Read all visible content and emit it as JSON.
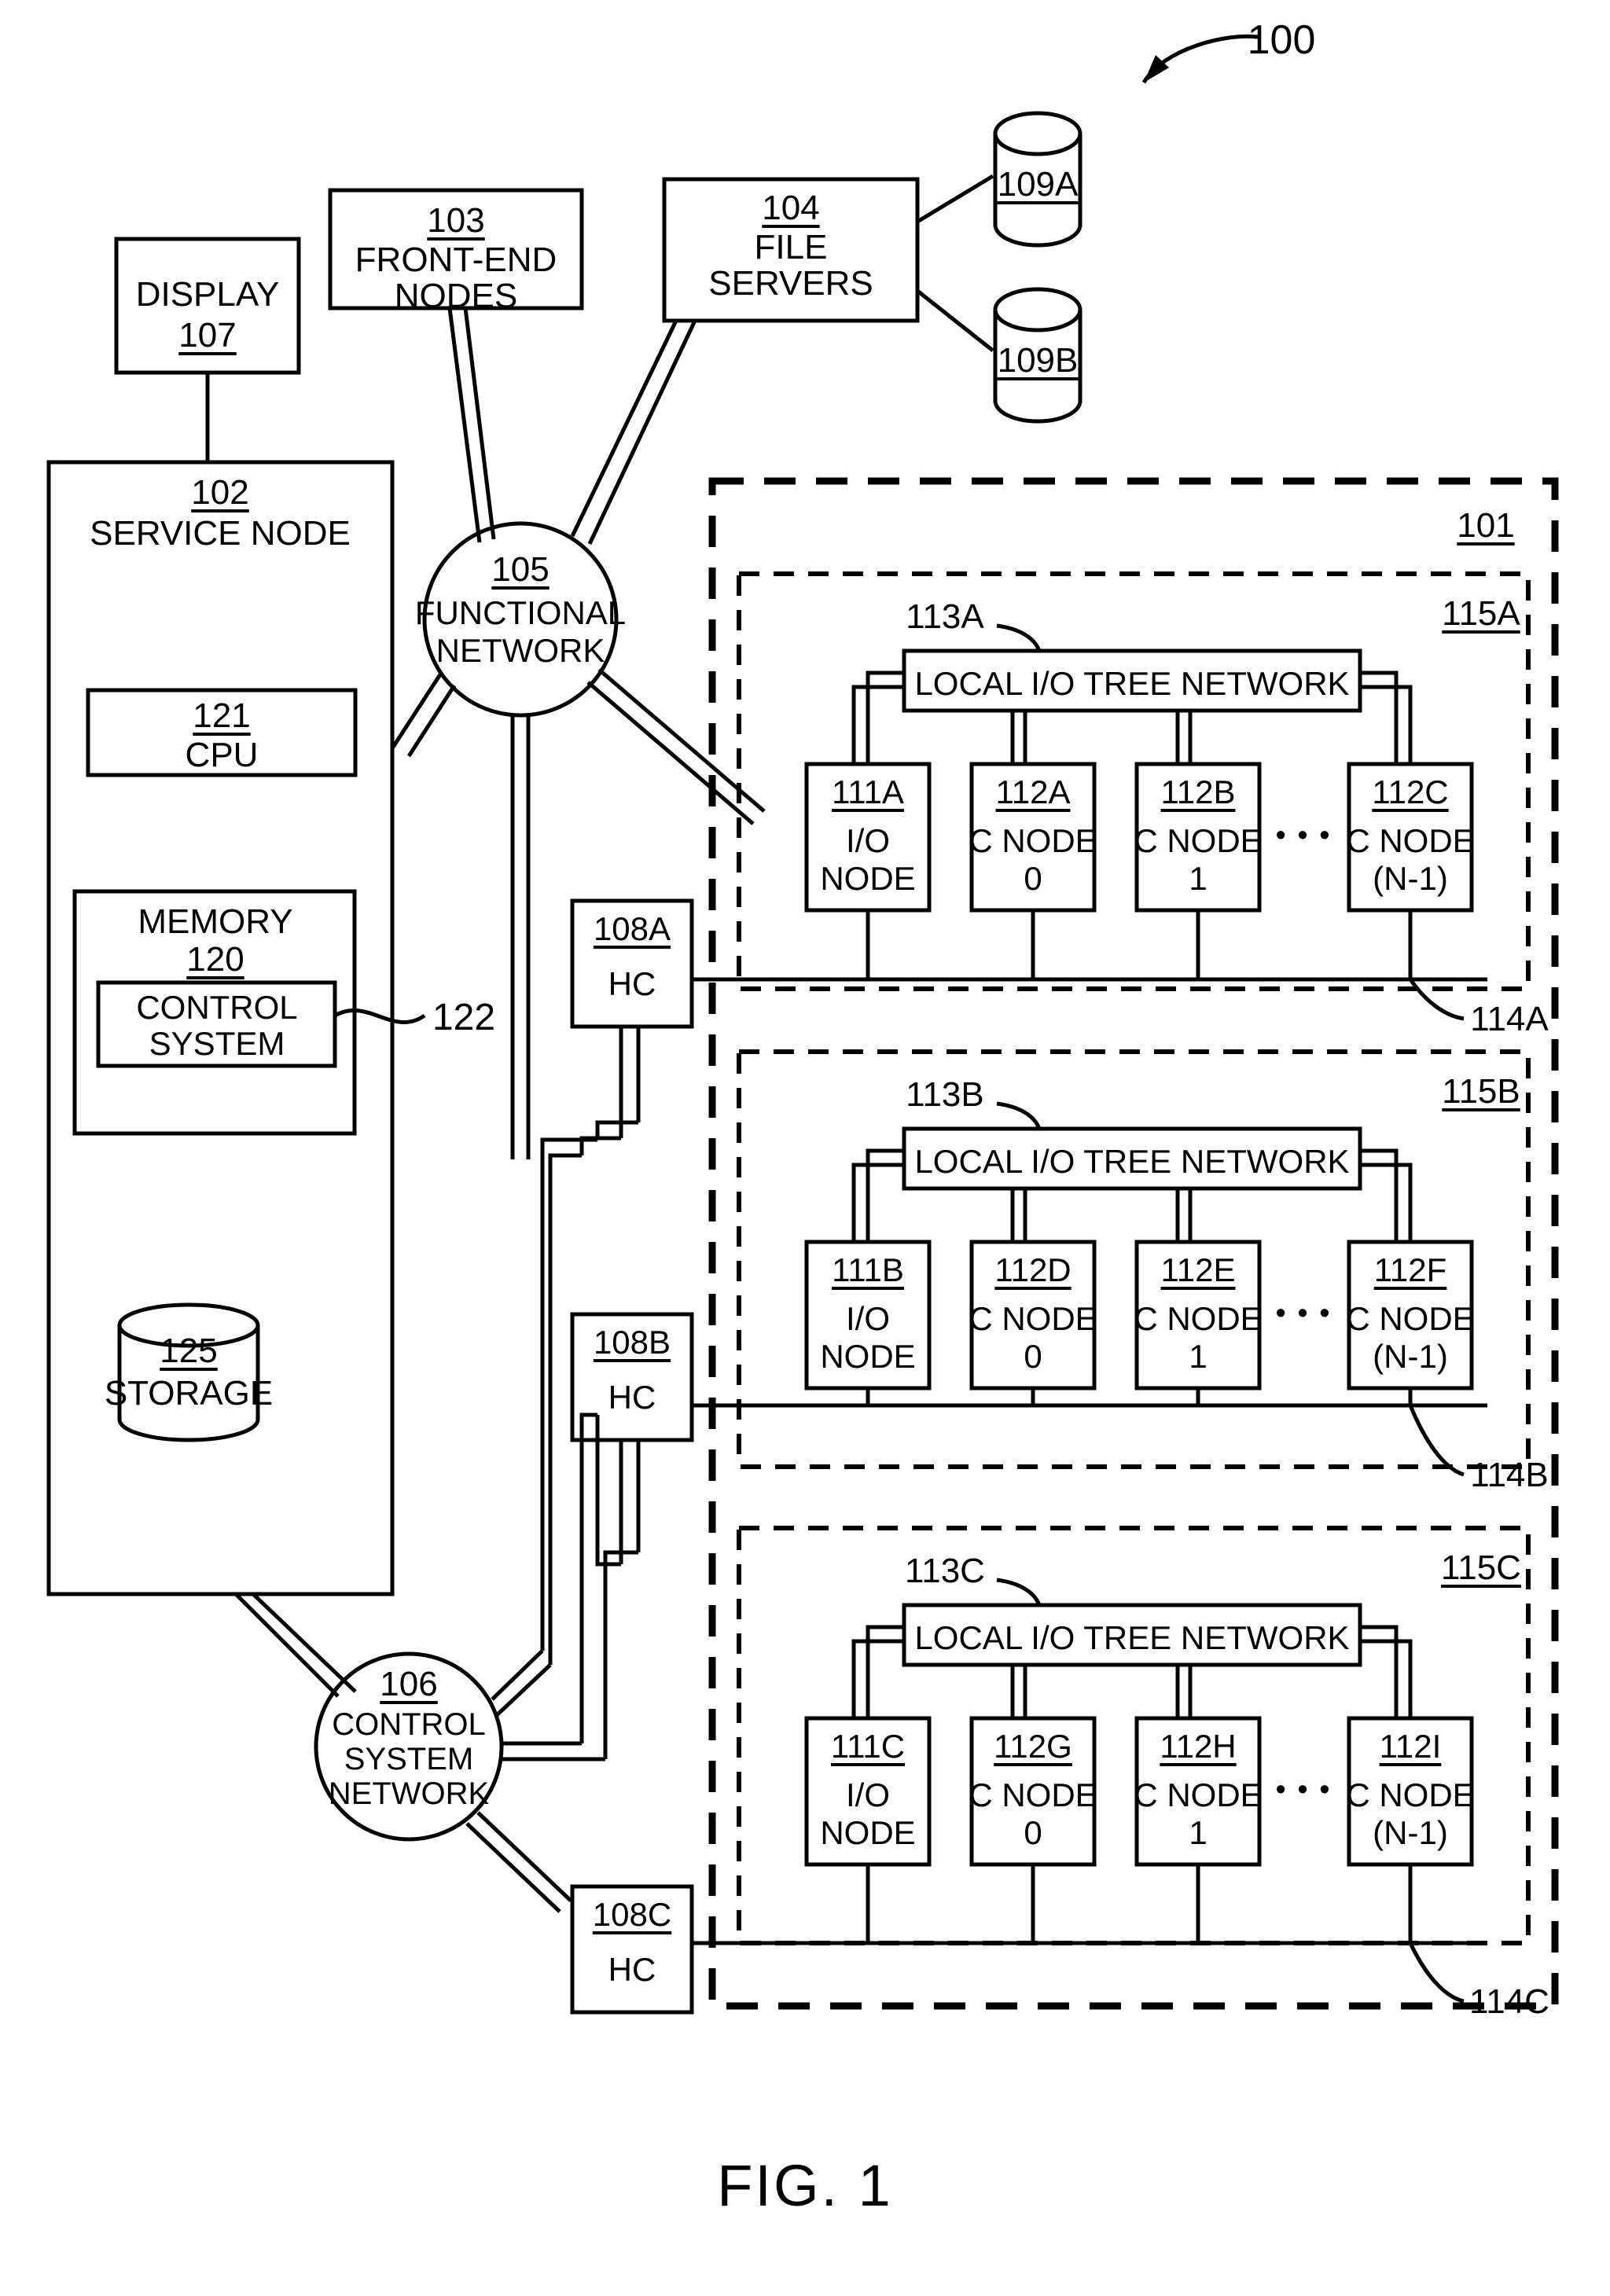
{
  "figure": {
    "caption": "FIG. 1",
    "system_ref": "100"
  },
  "blocks": {
    "display": {
      "ref": "107",
      "label": "DISPLAY"
    },
    "front_end_nodes": {
      "ref": "103",
      "label_line1": "FRONT-END",
      "label_line2": "NODES"
    },
    "file_servers": {
      "ref": "104",
      "label_line1": "FILE",
      "label_line2": "SERVERS"
    },
    "disk_a": {
      "ref": "109A"
    },
    "disk_b": {
      "ref": "109B"
    },
    "service_node": {
      "ref": "102",
      "label": "SERVICE NODE"
    },
    "cpu": {
      "ref": "121",
      "label": "CPU"
    },
    "memory": {
      "ref": "120",
      "label": "MEMORY"
    },
    "control_system": {
      "label_line1": "CONTROL",
      "label_line2": "SYSTEM",
      "callout_ref": "122"
    },
    "storage": {
      "ref": "125",
      "label": "STORAGE"
    },
    "functional_network": {
      "ref": "105",
      "label_line1": "FUNCTIONAL",
      "label_line2": "NETWORK"
    },
    "control_system_network": {
      "ref": "106",
      "label_line1": "CONTROL",
      "label_line2": "SYSTEM",
      "label_line3": "NETWORK"
    },
    "compute_core": {
      "ref": "101"
    }
  },
  "hardware_controllers": [
    {
      "ref": "108A",
      "label": "HC"
    },
    {
      "ref": "108B",
      "label": "HC"
    },
    {
      "ref": "108C",
      "label": "HC"
    }
  ],
  "groups": [
    {
      "group_ref": "115A",
      "tree_callout": "113A",
      "tree_label": "LOCAL I/O TREE NETWORK",
      "bus_callout": "114A",
      "ellipsis": "• • •",
      "nodes": [
        {
          "ref": "111A",
          "line1": "I/O",
          "line2": "NODE"
        },
        {
          "ref": "112A",
          "line1": "C NODE",
          "line2": "0"
        },
        {
          "ref": "112B",
          "line1": "C NODE",
          "line2": "1"
        },
        {
          "ref": "112C",
          "line1": "C NODE",
          "line2": "(N-1)"
        }
      ]
    },
    {
      "group_ref": "115B",
      "tree_callout": "113B",
      "tree_label": "LOCAL I/O TREE NETWORK",
      "bus_callout": "114B",
      "ellipsis": "• • •",
      "nodes": [
        {
          "ref": "111B",
          "line1": "I/O",
          "line2": "NODE"
        },
        {
          "ref": "112D",
          "line1": "C NODE",
          "line2": "0"
        },
        {
          "ref": "112E",
          "line1": "C NODE",
          "line2": "1"
        },
        {
          "ref": "112F",
          "line1": "C NODE",
          "line2": "(N-1)"
        }
      ]
    },
    {
      "group_ref": "115C",
      "tree_callout": "113C",
      "tree_label": "LOCAL I/O TREE NETWORK",
      "bus_callout": "114C",
      "ellipsis": "• • •",
      "nodes": [
        {
          "ref": "111C",
          "line1": "I/O",
          "line2": "NODE"
        },
        {
          "ref": "112G",
          "line1": "C NODE",
          "line2": "0"
        },
        {
          "ref": "112H",
          "line1": "C NODE",
          "line2": "1"
        },
        {
          "ref": "112I",
          "line1": "C NODE",
          "line2": "(N-1)"
        }
      ]
    }
  ],
  "colors": {
    "stroke": "#000000",
    "background": "#ffffff"
  }
}
